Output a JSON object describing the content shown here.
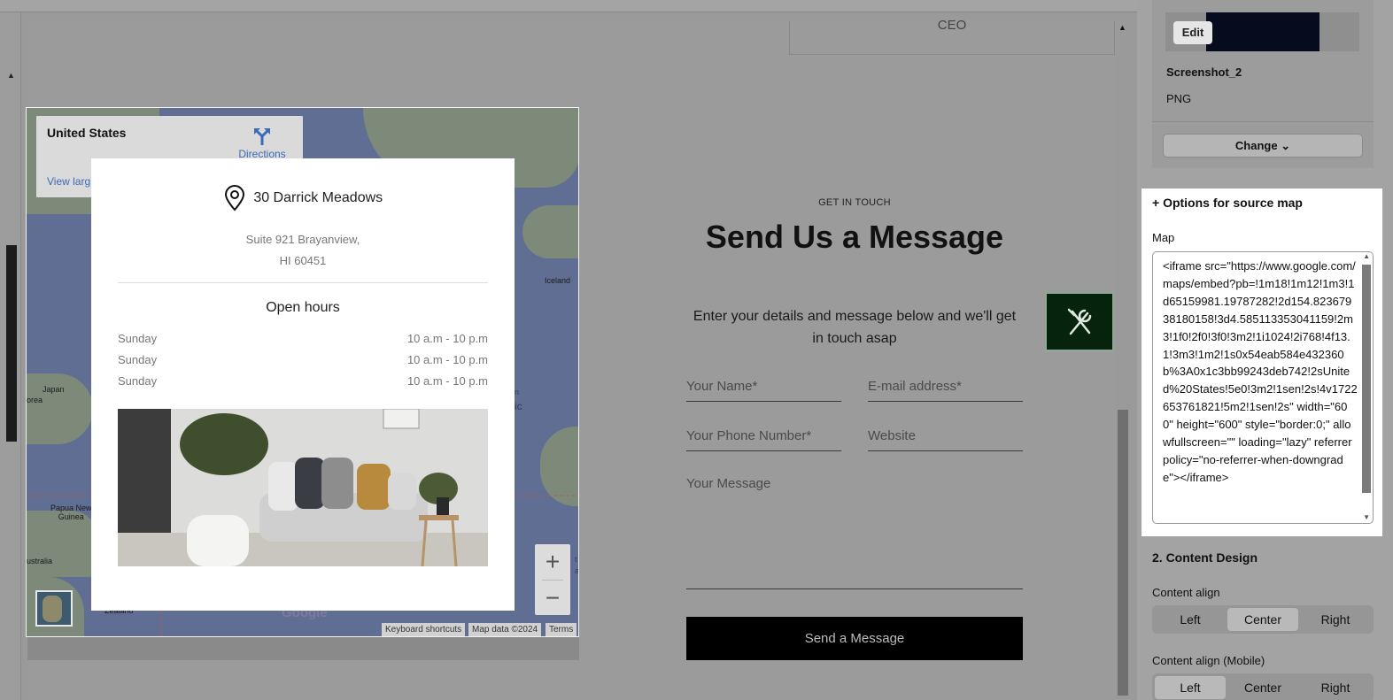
{
  "canvas": {
    "ceo_text": "CEO"
  },
  "map": {
    "info_title": "United States",
    "directions_label": "Directions",
    "view_larger_label": "View larg",
    "labels": {
      "iceland": "Iceland",
      "land_suffix": "nd",
      "japan": "Japan",
      "korea": "orea",
      "papua": "Papua New\nGuinea",
      "australia": "ustralia",
      "zealand": "Zealand",
      "pacific_a": "n",
      "pacific_b": "ic",
      "right_a": "t",
      "right_b": "a"
    },
    "zoom_in": "+",
    "zoom_out": "−",
    "google_logo": "Google",
    "attribution": {
      "keyboard": "Keyboard shortcuts",
      "data": "Map data ©2024",
      "terms": "Terms"
    }
  },
  "location_card": {
    "title": "30 Darrick Meadows",
    "address_line1": "Suite 921 Brayanview,",
    "address_line2": "HI 60451",
    "hours_title": "Open hours",
    "hours": [
      {
        "day": "Sunday",
        "time": "10 a.m - 10 p.m"
      },
      {
        "day": "Sunday",
        "time": "10 a.m - 10 p.m"
      },
      {
        "day": "Sunday",
        "time": "10 a.m - 10 p.m"
      }
    ]
  },
  "contact": {
    "eyebrow": "GET IN TOUCH",
    "title": "Send Us a Message",
    "description": "Enter your details and message below and we'll get in touch asap",
    "name_placeholder": "Your Name*",
    "email_placeholder": "E-mail address*",
    "phone_placeholder": "Your Phone Number*",
    "website_placeholder": "Website",
    "message_placeholder": "Your Message",
    "submit_label": "Send a Message"
  },
  "panel": {
    "edit_label": "Edit",
    "file_name": "Screenshot_2",
    "file_type": "PNG",
    "change_label": "Change",
    "source_map_title": "+ Options for source map",
    "map_field_label": "Map",
    "map_iframe_code": "<iframe src=\"https://www.google.com/maps/embed?pb=!1m18!1m12!1m3!1d65159981.19787282!2d154.82367938180158!3d4.585113353041159!2m3!1f0!2f0!3f0!3m2!1i1024!2i768!4f13.1!3m3!1m2!1s0x54eab584e432360b%3A0x1c3bb99243deb742!2sUnited%20States!5e0!3m2!1sen!2s!4v1722653761821!5m2!1sen!2s\" width=\"600\" height=\"600\" style=\"border:0;\" allowfullscreen=\"\" loading=\"lazy\" referrerpolicy=\"no-referrer-when-downgrade\"></iframe>",
    "content_design_title": "2. Content Design",
    "content_align_label": "Content align",
    "content_align_options": [
      "Left",
      "Center",
      "Right"
    ],
    "content_align_selected": "Center",
    "content_align_mobile_label": "Content align (Mobile)",
    "content_align_mobile_options": [
      "Left",
      "Center",
      "Right"
    ],
    "content_align_mobile_selected": "Left"
  },
  "colors": {
    "tools_button_bg": "#06230d",
    "link_blue": "#3d69b8",
    "send_button_bg": "#000000"
  }
}
